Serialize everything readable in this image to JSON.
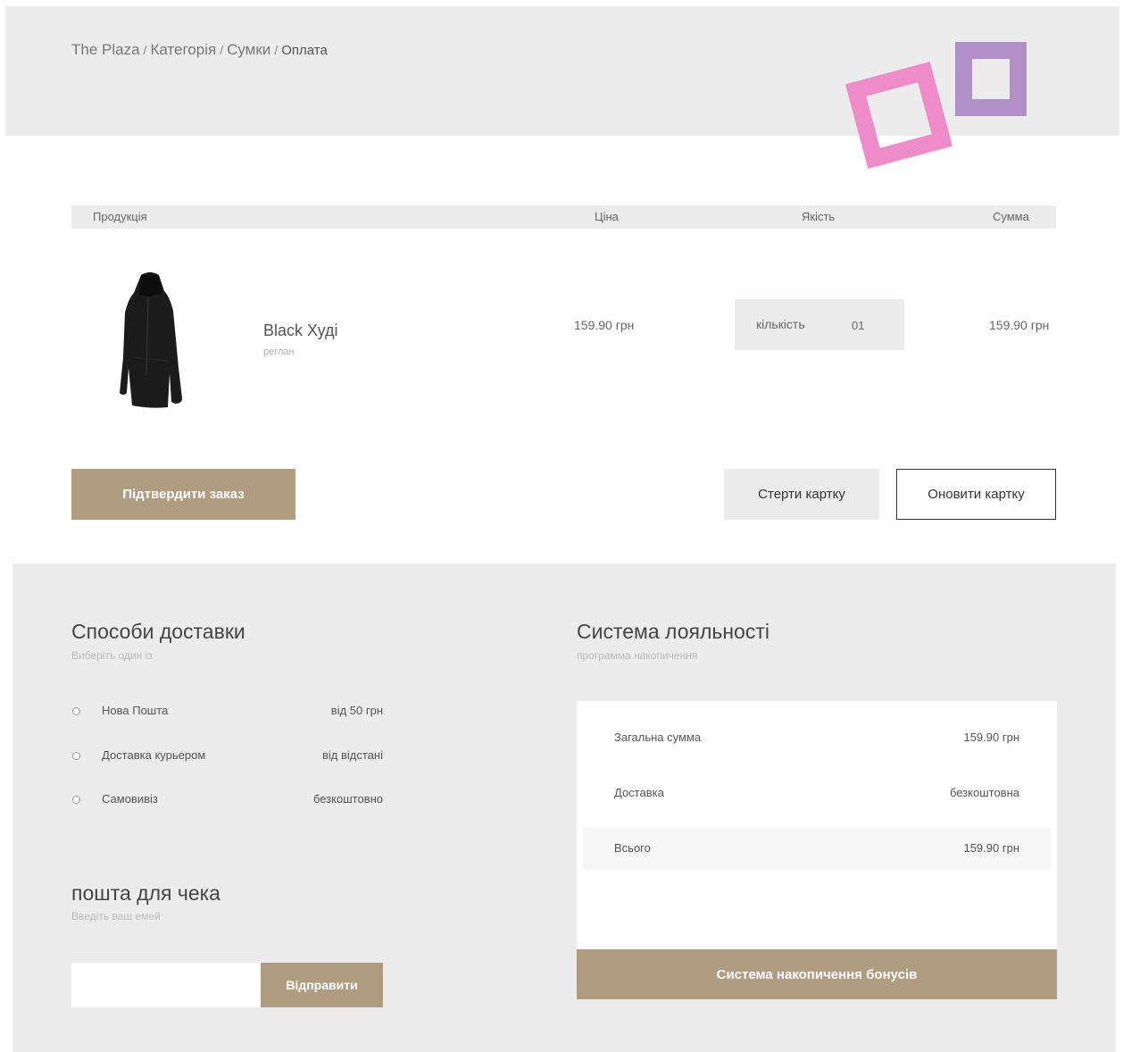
{
  "breadcrumb": {
    "items": [
      "The Plaza",
      "Категорія",
      "Сумки"
    ],
    "current": "Оплата",
    "separator": "/"
  },
  "table": {
    "headers": {
      "product": "Продукція",
      "price": "Ціна",
      "quality": "Якість",
      "sum": "Сумма"
    }
  },
  "product": {
    "name": "Black Худі",
    "subtitle": "реглан",
    "price": "159.90 грн",
    "qty_label": "кількість",
    "qty_value": "01",
    "total": "159.90 грн"
  },
  "actions": {
    "confirm": "Підтвердити заказ",
    "clear": "Стерти картку",
    "update": "Оновити картку"
  },
  "delivery": {
    "title": "Способи доставки",
    "subtitle": "Виберіть один із",
    "options": [
      {
        "label": "Нова Пошта",
        "price": "від 50 грн"
      },
      {
        "label": "Доставка курьером",
        "price": "від відстані"
      },
      {
        "label": "Самовивіз",
        "price": "безкоштовно"
      }
    ]
  },
  "receipt": {
    "title": "пошта для чека",
    "subtitle": "Введіть ваш емей",
    "email_value": "",
    "send": "Відправити"
  },
  "loyalty": {
    "title": "Система лояльності",
    "subtitle": "программа накопичення",
    "rows": [
      {
        "label": "Загальна сумма",
        "value": "159.90 грн"
      },
      {
        "label": "Доставка",
        "value": "безкоштовна"
      },
      {
        "label": "Всього",
        "value": "159.90 грн"
      }
    ],
    "bonus_button": "Система накопичення бонусів"
  },
  "colors": {
    "accent": "#b09c7e",
    "panel": "#ececec",
    "deco_pink": "#ee8bc9",
    "deco_purple": "#b18fc7"
  }
}
